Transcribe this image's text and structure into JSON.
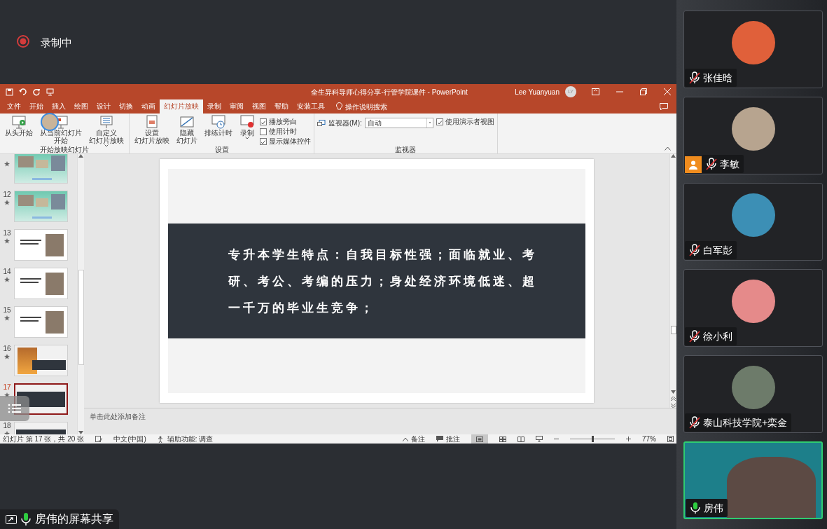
{
  "recording": {
    "label": "录制中"
  },
  "powerpoint": {
    "title": "全生异科导师心得分享-行管学院课件 - PowerPoint",
    "user": "Lee Yuanyuan",
    "user_initials": "LY",
    "tabs": [
      {
        "label": "文件",
        "selected": false
      },
      {
        "label": "开始",
        "selected": false
      },
      {
        "label": "插入",
        "selected": false
      },
      {
        "label": "绘图",
        "selected": false
      },
      {
        "label": "设计",
        "selected": false
      },
      {
        "label": "切换",
        "selected": false
      },
      {
        "label": "动画",
        "selected": false
      },
      {
        "label": "幻灯片放映",
        "selected": true
      },
      {
        "label": "录制",
        "selected": false
      },
      {
        "label": "审阅",
        "selected": false
      },
      {
        "label": "视图",
        "selected": false
      },
      {
        "label": "帮助",
        "selected": false
      },
      {
        "label": "安装工具",
        "selected": false
      }
    ],
    "tell_me": "操作说明搜索",
    "ribbon_groups": [
      {
        "label": "开始放映幻灯片",
        "items": [
          {
            "kind": "button",
            "label": "从头开始"
          },
          {
            "kind": "button",
            "label": [
              "从当前幻灯片",
              "开始"
            ]
          },
          {
            "kind": "dropdown-button",
            "label": [
              "自定义",
              "幻灯片放映"
            ]
          }
        ]
      },
      {
        "label": "设置",
        "items": [
          {
            "kind": "button",
            "label": [
              "设置",
              "幻灯片放映"
            ]
          },
          {
            "kind": "button",
            "label": [
              "隐藏",
              "幻灯片"
            ]
          },
          {
            "kind": "button",
            "label": "排练计时"
          },
          {
            "kind": "dropdown-button",
            "label": "录制"
          },
          {
            "kind": "checkboxes",
            "options": [
              {
                "label": "播放旁白",
                "checked": true
              },
              {
                "label": "使用计时",
                "checked": false
              },
              {
                "label": "显示媒体控件",
                "checked": true
              }
            ]
          }
        ]
      },
      {
        "label": "监视器",
        "items": [
          {
            "kind": "monitor",
            "label": "监视器(M):",
            "value": "自动"
          },
          {
            "kind": "checkboxes",
            "options": [
              {
                "label": "使用演示者视图",
                "checked": true
              }
            ]
          }
        ]
      }
    ],
    "slides": [
      {
        "kind": "green",
        "selected": false
      },
      {
        "number": "12",
        "kind": "green",
        "selected": false
      },
      {
        "number": "13",
        "kind": "white",
        "selected": false
      },
      {
        "number": "14",
        "kind": "white",
        "selected": false
      },
      {
        "number": "15",
        "kind": "white",
        "selected": false
      },
      {
        "number": "16",
        "kind": "banner",
        "selected": false
      },
      {
        "number": "17",
        "kind": "dark",
        "selected": true
      },
      {
        "number": "18",
        "kind": "dark",
        "selected": false
      }
    ],
    "current_slide": {
      "text": "专升本学生特点：自我目标性强；面临就业、考研、考公、考编的压力；身处经济环境低迷、超一千万的毕业生竞争；"
    },
    "notes_placeholder": "单击此处添加备注",
    "status_bar": {
      "slide_info": "幻灯片 第 17 张，共 20 张",
      "language": "中文(中国)",
      "accessibility": "辅助功能: 调查",
      "notes": "备注",
      "comments": "批注",
      "zoom": "77%",
      "level": 0.48
    }
  },
  "participants": [
    {
      "name": "张佳晗",
      "muted": true,
      "host": false,
      "video": false
    },
    {
      "name": "李敏",
      "muted": true,
      "host": true,
      "video": false
    },
    {
      "name": "白军彭",
      "muted": true,
      "host": false,
      "video": false
    },
    {
      "name": "徐小利",
      "muted": true,
      "host": false,
      "video": false
    },
    {
      "name": "泰山科技学院+栾金",
      "muted": true,
      "host": false,
      "video": false
    },
    {
      "name": "房伟",
      "muted": false,
      "host": false,
      "video": true
    }
  ],
  "screen_share": {
    "label": "房伟的屏幕共享"
  }
}
